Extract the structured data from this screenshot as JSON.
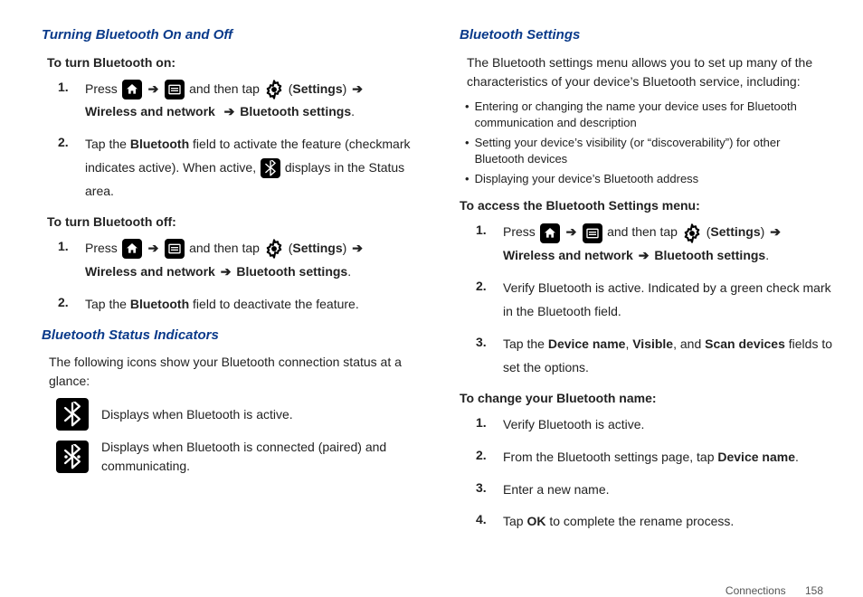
{
  "left": {
    "h1": "Turning Bluetooth On and Off",
    "on_heading": "To turn Bluetooth on:",
    "off_heading": "To turn Bluetooth off:",
    "step_press": "Press",
    "step_andthentap": "and then tap",
    "label_settings": "Settings",
    "label_wireless": "Wireless and network",
    "label_btsettings": "Bluetooth settings",
    "arrow": "➔",
    "on_step2_a": "Tap the ",
    "on_step2_bold": "Bluetooth",
    "on_step2_b": " field to activate the feature (checkmark indicates active). When active, ",
    "on_step2_c": " displays in the Status area.",
    "off_step2_a": "Tap the ",
    "off_step2_bold": "Bluetooth",
    "off_step2_b": " field to deactivate the feature.",
    "h2": "Bluetooth Status Indicators",
    "status_intro": "The following icons show your Bluetooth connection status at a glance:",
    "status1": "Displays when Bluetooth is active.",
    "status2": "Displays when Bluetooth is connected (paired) and communicating."
  },
  "right": {
    "h1": "Bluetooth Settings",
    "intro": "The Bluetooth settings menu allows you to set up many of the characteristics of your device’s Bluetooth service, including:",
    "b1": "Entering or changing the name your device uses for Bluetooth communication and description",
    "b2": "Setting your device’s visibility (or “discoverability”) for other Bluetooth devices",
    "b3": "Displaying your device’s Bluetooth address",
    "access_heading": "To access the Bluetooth Settings menu:",
    "step2": "Verify Bluetooth is active. Indicated by a green check mark in the Bluetooth field.",
    "step3_a": "Tap the ",
    "step3_bold1": "Device name",
    "step3_sep1": ", ",
    "step3_bold2": "Visible",
    "step3_sep2": ", and ",
    "step3_bold3": "Scan devices",
    "step3_b": " fields to set the options.",
    "change_heading": "To change your Bluetooth name:",
    "c1": "Verify Bluetooth is active.",
    "c2_a": "From the Bluetooth settings page, tap ",
    "c2_bold": "Device name",
    "c2_b": ".",
    "c3": "Enter a new name.",
    "c4_a": "Tap ",
    "c4_bold": "OK",
    "c4_b": " to complete the rename process."
  },
  "nums": {
    "n1": "1.",
    "n2": "2.",
    "n3": "3.",
    "n4": "4."
  },
  "footer": {
    "section": "Connections",
    "page": "158"
  }
}
